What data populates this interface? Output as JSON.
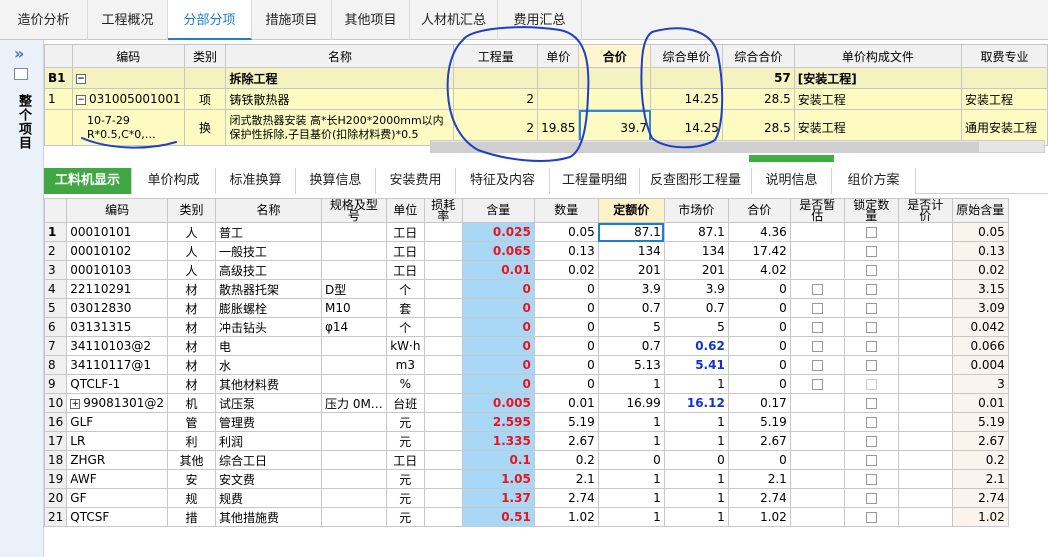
{
  "nav": {
    "tabs": [
      "造价分析",
      "工程概况",
      "分部分项",
      "措施项目",
      "其他项目",
      "人材机汇总",
      "费用汇总"
    ]
  },
  "sidebar": {
    "vertical_title": "整个项目"
  },
  "upper_table": {
    "headers": [
      "编码",
      "类别",
      "名称",
      "工程量",
      "单价",
      "合价",
      "综合单价",
      "综合合价",
      "单价构成文件",
      "取费专业"
    ],
    "section_row": {
      "rownum": "B1",
      "name": "拆除工程",
      "total": "57",
      "file": "[安装工程]"
    },
    "rows": [
      {
        "rownum": "1",
        "code": "031005001001",
        "type": "项",
        "name": "铸铁散热器",
        "qty": "2",
        "price": "",
        "total": "",
        "unit_price": "14.25",
        "combined": "28.5",
        "file": "安装工程",
        "specialty": "安装工程"
      },
      {
        "rownum": "",
        "code_line1": "10-7-29",
        "code_line2": "R*0.5,C*0,…",
        "type": "换",
        "name_line1": "闭式散热器安装 高*长H200*2000mm以内",
        "name_line2": "保护性拆除,子目基价(扣除材料费)*0.5",
        "qty": "2",
        "price": "19.85",
        "total": "39.7",
        "unit_price": "14.25",
        "combined": "28.5",
        "file": "安装工程",
        "specialty": "通用安装工程"
      }
    ]
  },
  "detail_tabs": [
    "工料机显示",
    "单价构成",
    "标准换算",
    "换算信息",
    "安装费用",
    "特征及内容",
    "工程量明细",
    "反查图形工程量",
    "说明信息",
    "组价方案"
  ],
  "detail_table": {
    "headers": [
      "编码",
      "类别",
      "名称",
      "规格及型号",
      "单位",
      "损耗率",
      "含量",
      "数量",
      "定额价",
      "市场价",
      "合价",
      "是否暂估",
      "锁定数量",
      "是否计价",
      "原始含量"
    ],
    "rows": [
      {
        "n": "1",
        "code": "00010101",
        "type": "人",
        "name": "普工",
        "spec": "",
        "unit": "工日",
        "qty": "0.025",
        "amount": "0.05",
        "quota": "87.1",
        "market": "87.1",
        "total": "4.36",
        "orig": "0.05"
      },
      {
        "n": "2",
        "code": "00010102",
        "type": "人",
        "name": "一般技工",
        "spec": "",
        "unit": "工日",
        "qty": "0.065",
        "amount": "0.13",
        "quota": "134",
        "market": "134",
        "total": "17.42",
        "orig": "0.13"
      },
      {
        "n": "3",
        "code": "00010103",
        "type": "人",
        "name": "高级技工",
        "spec": "",
        "unit": "工日",
        "qty": "0.01",
        "amount": "0.02",
        "quota": "201",
        "market": "201",
        "total": "4.02",
        "orig": "0.02"
      },
      {
        "n": "4",
        "code": "22110291",
        "type": "材",
        "name": "散热器托架",
        "spec": "D型",
        "unit": "个",
        "qty": "0",
        "amount": "0",
        "quota": "3.9",
        "market": "3.9",
        "total": "0",
        "orig": "3.15"
      },
      {
        "n": "5",
        "code": "03012830",
        "type": "材",
        "name": "膨胀螺栓",
        "spec": "M10",
        "unit": "套",
        "qty": "0",
        "amount": "0",
        "quota": "0.7",
        "market": "0.7",
        "total": "0",
        "orig": "3.09"
      },
      {
        "n": "6",
        "code": "03131315",
        "type": "材",
        "name": "冲击钻头",
        "spec": "φ14",
        "unit": "个",
        "qty": "0",
        "amount": "0",
        "quota": "5",
        "market": "5",
        "total": "0",
        "orig": "0.042"
      },
      {
        "n": "7",
        "code": "34110103@2",
        "type": "材",
        "name": "电",
        "spec": "",
        "unit": "kW·h",
        "qty": "0",
        "amount": "0",
        "quota": "0.7",
        "market": "0.62",
        "total": "0",
        "orig": "0.066"
      },
      {
        "n": "8",
        "code": "34110117@1",
        "type": "材",
        "name": "水",
        "spec": "",
        "unit": "m3",
        "qty": "0",
        "amount": "0",
        "quota": "5.13",
        "market": "5.41",
        "total": "0",
        "orig": "0.004"
      },
      {
        "n": "9",
        "code": "QTCLF-1",
        "type": "材",
        "name": "其他材料费",
        "spec": "",
        "unit": "%",
        "qty": "0",
        "amount": "0",
        "quota": "1",
        "market": "1",
        "total": "0",
        "orig": "3"
      },
      {
        "n": "10",
        "code": "99081301@2",
        "type": "机",
        "name": "试压泵",
        "spec": "压力 0M…",
        "unit": "台班",
        "qty": "0.005",
        "amount": "0.01",
        "quota": "16.99",
        "market": "16.12",
        "total": "0.17",
        "orig": "0.01"
      },
      {
        "n": "16",
        "code": "GLF",
        "type": "管",
        "name": "管理费",
        "spec": "",
        "unit": "元",
        "qty": "2.595",
        "amount": "5.19",
        "quota": "1",
        "market": "1",
        "total": "5.19",
        "orig": "5.19"
      },
      {
        "n": "17",
        "code": "LR",
        "type": "利",
        "name": "利润",
        "spec": "",
        "unit": "元",
        "qty": "1.335",
        "amount": "2.67",
        "quota": "1",
        "market": "1",
        "total": "2.67",
        "orig": "2.67"
      },
      {
        "n": "18",
        "code": "ZHGR",
        "type": "其他",
        "name": "综合工日",
        "spec": "",
        "unit": "工日",
        "qty": "0.1",
        "amount": "0.2",
        "quota": "0",
        "market": "0",
        "total": "0",
        "orig": "0.2"
      },
      {
        "n": "19",
        "code": "AWF",
        "type": "安",
        "name": "安文费",
        "spec": "",
        "unit": "元",
        "qty": "1.05",
        "amount": "2.1",
        "quota": "1",
        "market": "1",
        "total": "2.1",
        "orig": "2.1"
      },
      {
        "n": "20",
        "code": "GF",
        "type": "规",
        "name": "规费",
        "spec": "",
        "unit": "元",
        "qty": "1.37",
        "amount": "2.74",
        "quota": "1",
        "market": "1",
        "total": "2.74",
        "orig": "2.74"
      },
      {
        "n": "21",
        "code": "QTCSF",
        "type": "措",
        "name": "其他措施费",
        "spec": "",
        "unit": "元",
        "qty": "0.51",
        "amount": "1.02",
        "quota": "1",
        "market": "1",
        "total": "1.02",
        "orig": "1.02"
      }
    ]
  },
  "colors": {
    "accent": "#1b7fd1",
    "active_tab": "#3fa844",
    "qty_fill": "#a9d8f6",
    "qty_text": "#e8141e",
    "row_yellow": "#fdfbc2",
    "annotation_ink": "#1f3fc4"
  }
}
